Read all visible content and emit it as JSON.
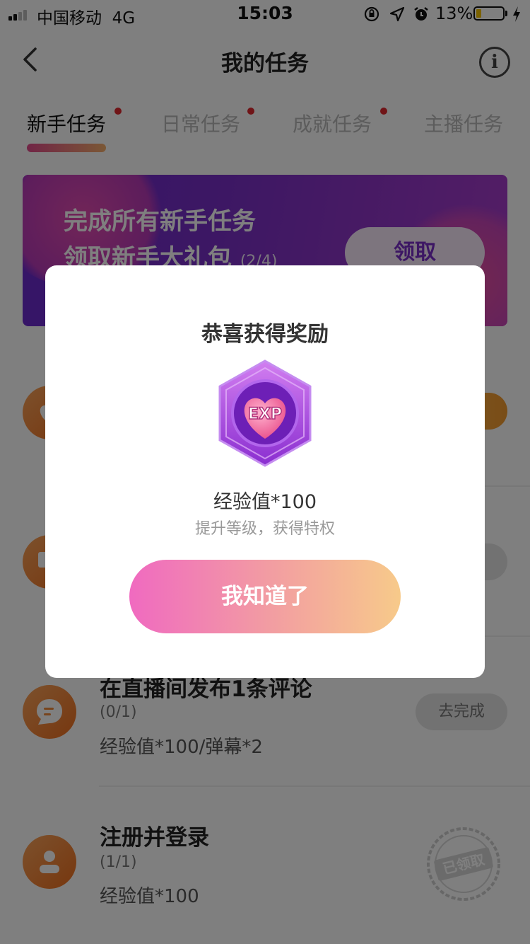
{
  "status_bar": {
    "carrier": "中国移动",
    "network": "4G",
    "time": "15:03",
    "battery_percent": "13%",
    "icons": [
      "orientation-lock-icon",
      "location-arrow-icon",
      "alarm-icon",
      "charging-bolt-icon"
    ]
  },
  "nav": {
    "title": "我的任务",
    "back_icon": "chevron-left-icon",
    "info_icon": "info-icon",
    "info_glyph": "i"
  },
  "tabs": [
    {
      "label": "新手任务",
      "active": true,
      "has_dot": true
    },
    {
      "label": "日常任务",
      "active": false,
      "has_dot": true
    },
    {
      "label": "成就任务",
      "active": false,
      "has_dot": true
    },
    {
      "label": "主播任务",
      "active": false,
      "has_dot": false
    }
  ],
  "banner": {
    "line1": "完成所有新手任务",
    "line2": "领取新手大礼包",
    "progress": "(2/4)",
    "button": "领取"
  },
  "tasks": [
    {
      "icon": "heart-icon",
      "title": "",
      "progress": "",
      "reward": "",
      "button": ""
    },
    {
      "icon": "monitor-icon",
      "title": "",
      "progress": "",
      "reward": "",
      "button": ""
    },
    {
      "icon": "chat-bubble-icon",
      "title": "在直播间发布1条评论",
      "progress": "(0/1)",
      "reward": "经验值*100/弹幕*2",
      "button": "去完成"
    },
    {
      "icon": "user-icon",
      "title": "注册并登录",
      "progress": "(1/1)",
      "reward": "经验值*100",
      "stamp": "已领取"
    }
  ],
  "modal": {
    "title": "恭喜获得奖励",
    "badge_text": "EXP",
    "reward_name": "经验值*100",
    "reward_desc": "提升等级，获得特权",
    "button": "我知道了"
  },
  "colors": {
    "accent_gradient_start": "#f06ac0",
    "accent_gradient_end": "#f7ca8a",
    "tab_dot": "#e0282e",
    "banner_purple": "#6a2ad0",
    "task_icon_orange": "#ee6e1e"
  }
}
